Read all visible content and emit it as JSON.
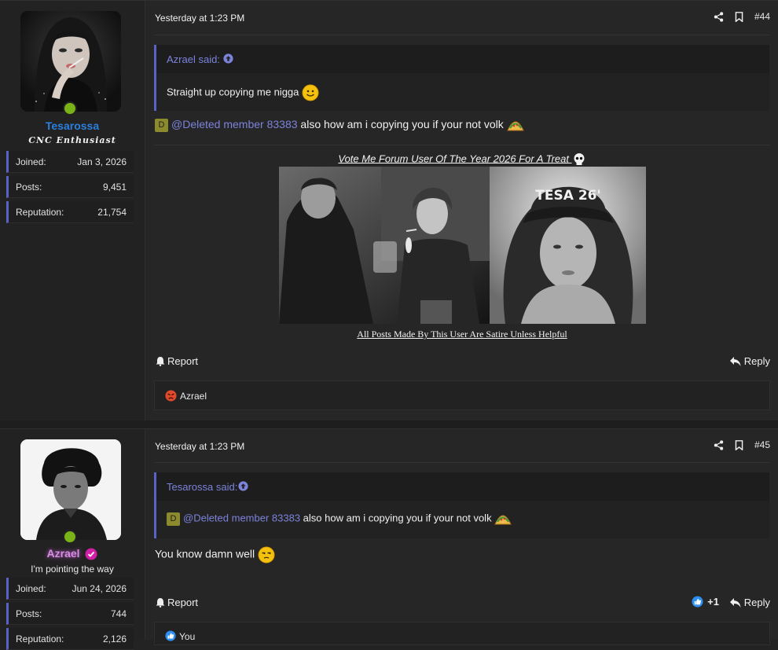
{
  "post1": {
    "user": {
      "name": "Tesarossa",
      "title": "CNC Enthusiast",
      "name_color": "#2c7fdc"
    },
    "stats": [
      {
        "k": "Joined:",
        "v": "Jan 3, 2026"
      },
      {
        "k": "Posts:",
        "v": "9,451"
      },
      {
        "k": "Reputation:",
        "v": "21,754"
      }
    ],
    "date": "Yesterday at 1:23 PM",
    "number": "#44",
    "quote": {
      "author": "Azrael said:",
      "text": "Straight up copying me nigga"
    },
    "body": {
      "badge": "D",
      "mention": "@Deleted member 83383",
      "text": " also how am i copying you if your not volk"
    },
    "signature": {
      "title": "Vote Me Forum User Of The Year 2026 For A Treat",
      "cap_text": "TESA 26'",
      "footer": "All Posts Made By This User Are Satire Unless Helpful"
    },
    "report": "Report",
    "reply": "Reply",
    "reaction_user": "Azrael"
  },
  "post2": {
    "user": {
      "name": "Azrael",
      "title": "I'm pointing the way"
    },
    "stats": [
      {
        "k": "Joined:",
        "v": "Jun 24, 2026"
      },
      {
        "k": "Posts:",
        "v": "744"
      },
      {
        "k": "Reputation:",
        "v": "2,126"
      }
    ],
    "date": "Yesterday at 1:23 PM",
    "number": "#45",
    "quote": {
      "author": "Tesarossa said:",
      "badge": "D",
      "mention": "@Deleted member 83383",
      "text": " also how am i copying you if your not volk"
    },
    "body": "You know damn well",
    "report": "Report",
    "likes": "+1",
    "reply": "Reply",
    "reaction_user": "You"
  },
  "colors": {
    "accent": "#5a62c8",
    "link": "#7b83db",
    "online": "#7ab317",
    "bg": "#262626"
  }
}
